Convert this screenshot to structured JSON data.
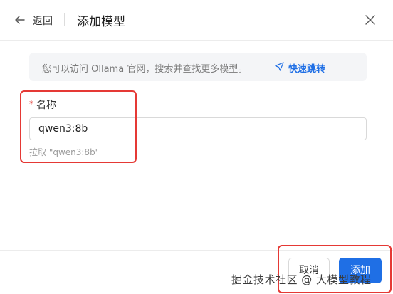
{
  "header": {
    "back_label": "返回",
    "title": "添加模型"
  },
  "banner": {
    "text": "您可以访问 Ollama 官网，搜索并查找更多模型。",
    "link_label": "快速跳转"
  },
  "form": {
    "required_mark": "*",
    "name_label": "名称",
    "name_value": "qwen3:8b",
    "hint": "拉取 \"qwen3:8b\""
  },
  "footer": {
    "cancel_label": "取消",
    "add_label": "添加"
  },
  "watermark": "掘金技术社区 @ 大模型教程",
  "colors": {
    "accent": "#1f6fe5",
    "annotation": "#e53935",
    "required": "#e0403a"
  }
}
